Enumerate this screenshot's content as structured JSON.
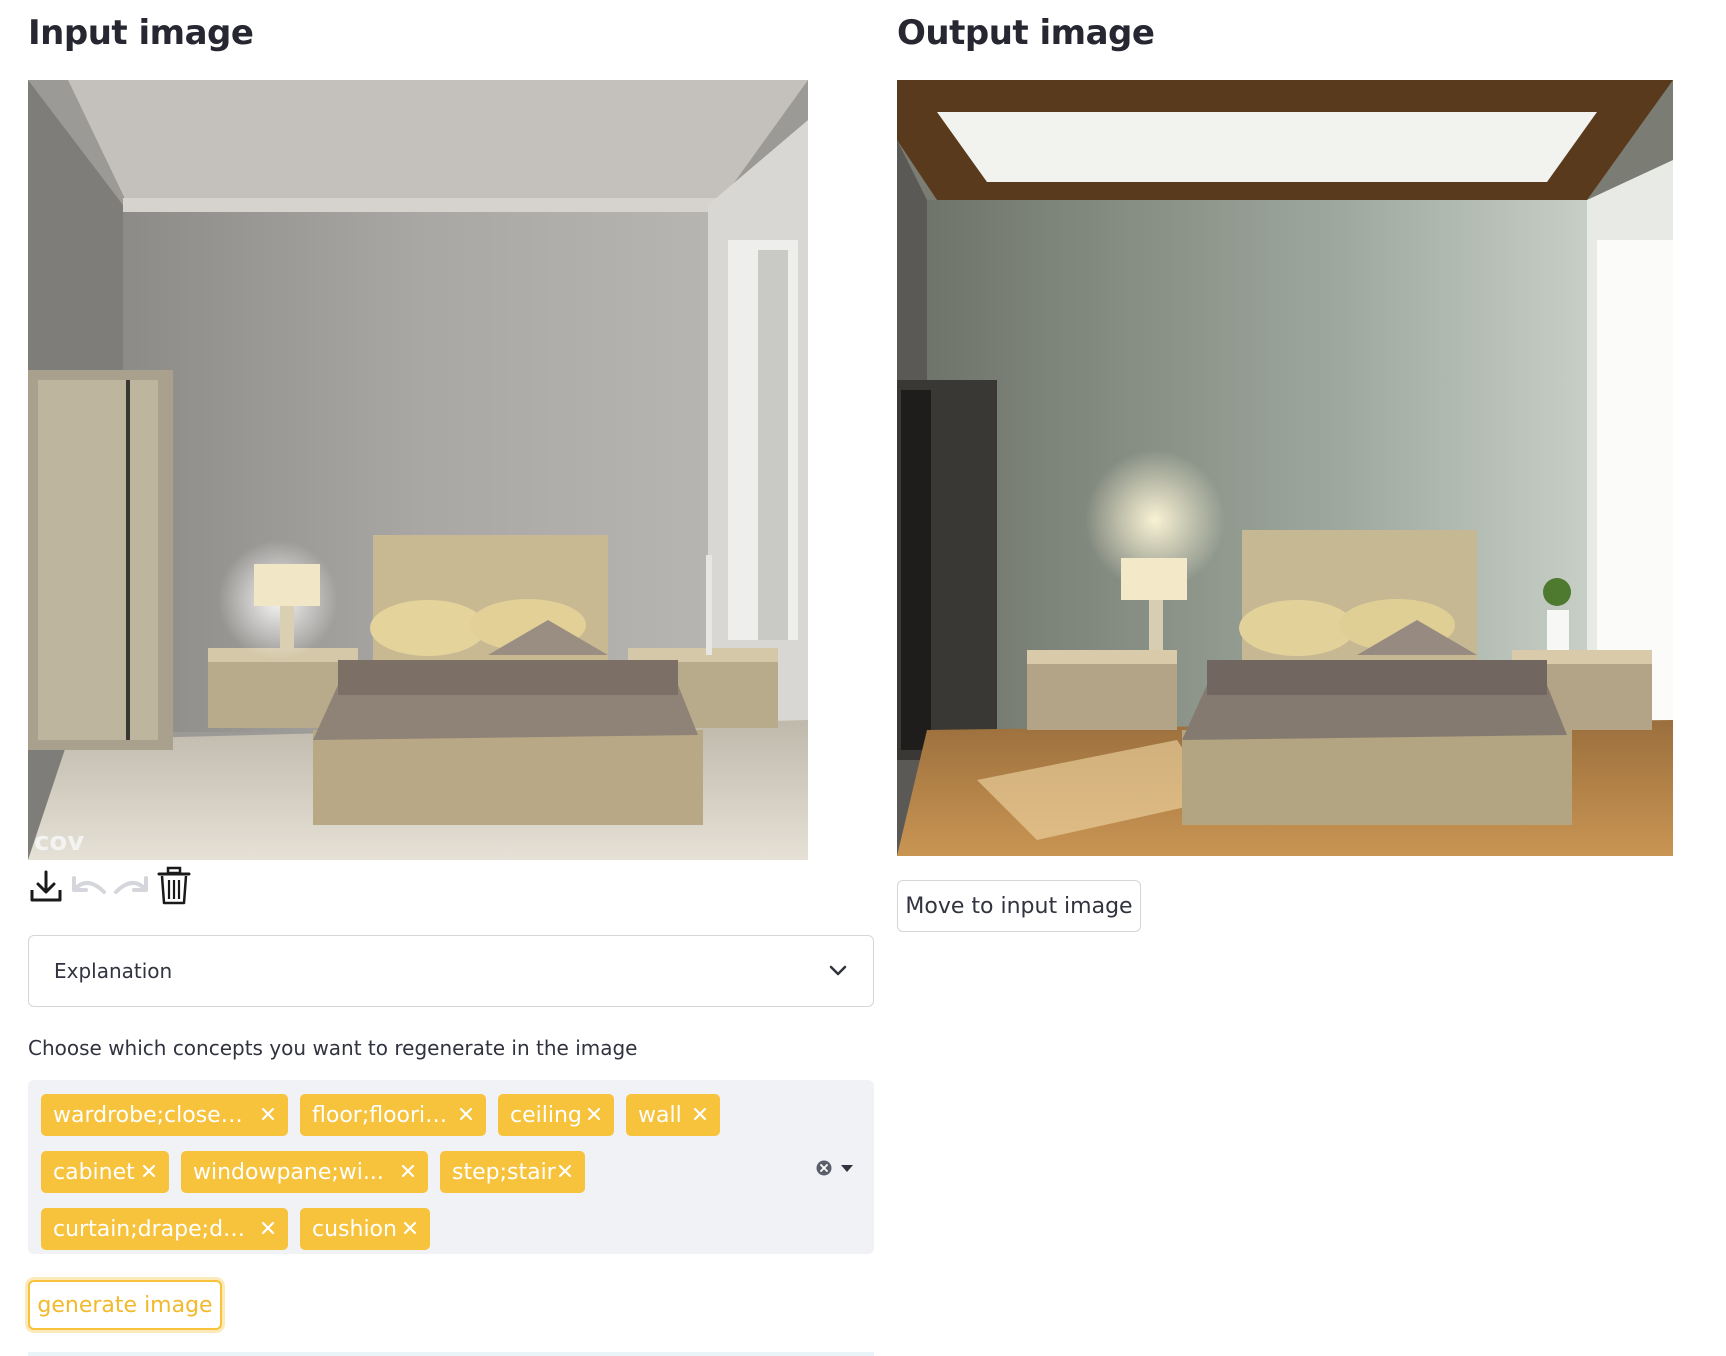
{
  "input_column": {
    "title": "Input image",
    "watermark": "cov",
    "toolbar": {
      "download_icon": "download-icon",
      "undo_icon": "undo-icon",
      "redo_icon": "redo-icon",
      "delete_icon": "trash-icon"
    },
    "explanation": {
      "label": "Explanation",
      "icon": "chevron-down-icon"
    },
    "concepts_label": "Choose which concepts you want to regenerate in the image",
    "concepts": [
      "wardrobe;closet;...",
      "floor;flooring",
      "ceiling",
      "wall",
      "cabinet",
      "windowpane;wi...",
      "step;stair",
      "curtain;drape;dr...",
      "cushion"
    ],
    "generate_button": "generate image"
  },
  "output_column": {
    "title": "Output image",
    "move_button": "Move to input image"
  },
  "colors": {
    "accent": "#f7c23c",
    "text": "#31333f",
    "border": "#d6d6d9",
    "multiselect_bg": "#f0f2f6"
  }
}
